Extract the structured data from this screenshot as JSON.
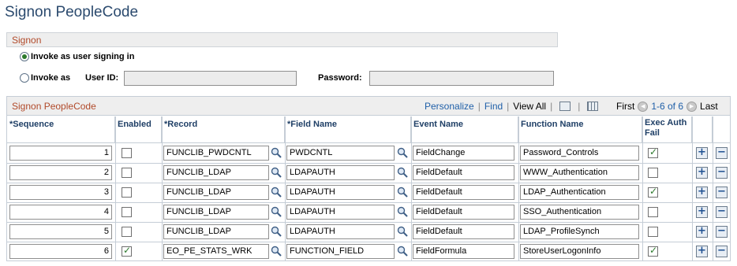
{
  "page_title": "Signon PeopleCode",
  "signon_section": {
    "title": "Signon",
    "radio_user": "Invoke as user signing in",
    "radio_user_checked": true,
    "radio_invoke_as": "Invoke as",
    "radio_invoke_as_checked": false,
    "user_id_label": "User ID:",
    "user_id_value": "",
    "password_label": "Password:",
    "password_value": ""
  },
  "grid": {
    "title": "Signon PeopleCode",
    "personalize": "Personalize",
    "find": "Find",
    "view_all": "View All",
    "first": "First",
    "range": "1-6 of 6",
    "last": "Last",
    "columns": {
      "sequence": "*Sequence",
      "enabled": "Enabled",
      "record": "*Record",
      "field_name": "*Field Name",
      "event_name": "Event Name",
      "function_name": "Function Name",
      "exec_auth_fail": "Exec Auth Fail"
    },
    "rows": [
      {
        "sequence": "1",
        "enabled": false,
        "record": "FUNCLIB_PWDCNTL",
        "field": "PWDCNTL",
        "event": "FieldChange",
        "function": "Password_Controls",
        "exec": true
      },
      {
        "sequence": "2",
        "enabled": false,
        "record": "FUNCLIB_LDAP",
        "field": "LDAPAUTH",
        "event": "FieldDefault",
        "function": "WWW_Authentication",
        "exec": false
      },
      {
        "sequence": "3",
        "enabled": false,
        "record": "FUNCLIB_LDAP",
        "field": "LDAPAUTH",
        "event": "FieldDefault",
        "function": "LDAP_Authentication",
        "exec": true
      },
      {
        "sequence": "4",
        "enabled": false,
        "record": "FUNCLIB_LDAP",
        "field": "LDAPAUTH",
        "event": "FieldDefault",
        "function": "SSO_Authentication",
        "exec": false
      },
      {
        "sequence": "5",
        "enabled": false,
        "record": "FUNCLIB_LDAP",
        "field": "LDAPAUTH",
        "event": "FieldDefault",
        "function": "LDAP_ProfileSynch",
        "exec": false
      },
      {
        "sequence": "6",
        "enabled": true,
        "record": "EO_PE_STATS_WRK",
        "field": "FUNCTION_FIELD",
        "event": "FieldFormula",
        "function": "StoreUserLogonInfo",
        "exec": true
      }
    ],
    "add_symbol": "+",
    "delete_symbol": "−"
  },
  "icons": {
    "lookup": "magnifier-icon",
    "zoom": "zoom-icon",
    "download": "grid-download-icon",
    "first": "first-arrow-icon",
    "last": "last-arrow-icon",
    "add": "add-row-icon",
    "delete": "delete-row-icon"
  },
  "colors": {
    "title": "#2b4a6e",
    "section_title": "#b14a2a",
    "link": "#1f5fa8",
    "check": "#2c7a2c"
  }
}
